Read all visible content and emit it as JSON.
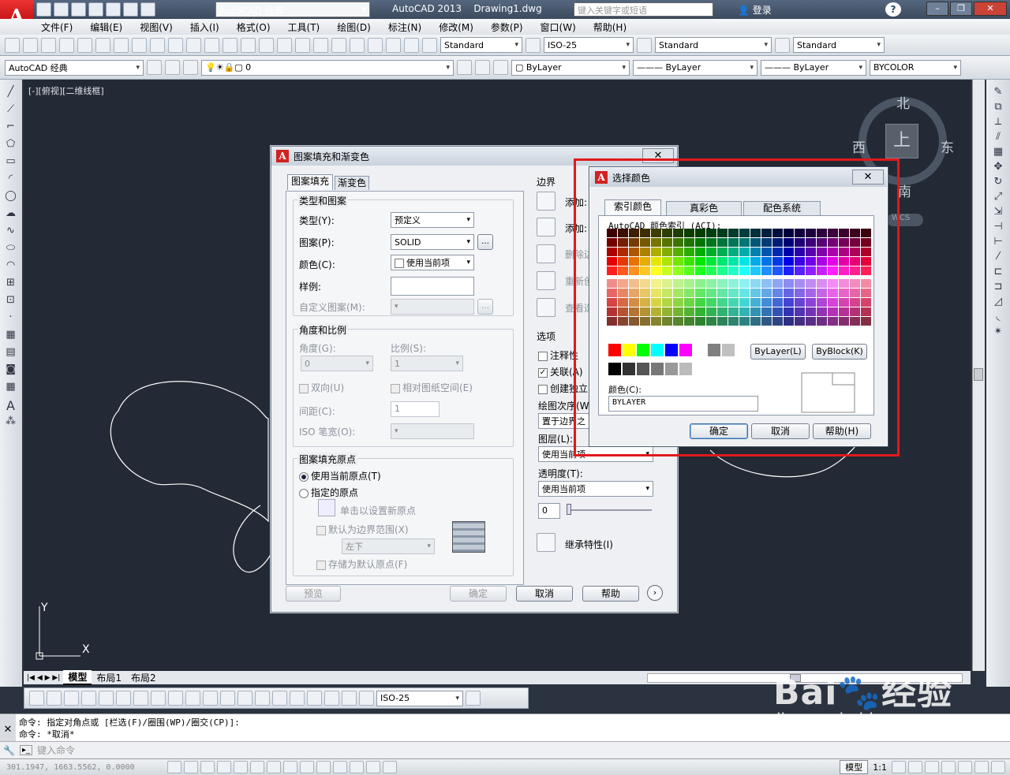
{
  "app": {
    "title": "AutoCAD 2013",
    "document": "Drawing1.dwg",
    "workspace": "AutoCAD 经典",
    "search_placeholder": "键入关键字或短语",
    "login": "登录"
  },
  "menu": [
    "文件(F)",
    "编辑(E)",
    "视图(V)",
    "插入(I)",
    "格式(O)",
    "工具(T)",
    "绘图(D)",
    "标注(N)",
    "修改(M)",
    "参数(P)",
    "窗口(W)",
    "帮助(H)"
  ],
  "toolbar": {
    "text_style": "Standard",
    "dim_style": "ISO-25",
    "table_style": "Standard",
    "mleader_style": "Standard",
    "workspace2": "AutoCAD 经典",
    "layer": "0",
    "color": "ByLayer",
    "linetype": "ByLayer",
    "lineweight": "ByLayer",
    "plotstyle": "BYCOLOR"
  },
  "viewport": {
    "label": "[-][俯视][二维线框]",
    "compass": {
      "n": "北",
      "s": "南",
      "w": "西",
      "e": "东",
      "top": "上",
      "wcs": "WCS"
    },
    "ucs_x": "X",
    "ucs_y": "Y"
  },
  "hatch_dialog": {
    "title": "图案填充和渐变色",
    "tabs": [
      "图案填充",
      "渐变色"
    ],
    "type_pattern": "类型和图案",
    "type_label": "类型(Y):",
    "type_value": "预定义",
    "pattern_label": "图案(P):",
    "pattern_value": "SOLID",
    "color_label": "颜色(C):",
    "color_value": "使用当前项",
    "swatch_label": "样例:",
    "custom_label": "自定义图案(M):",
    "angle_scale": "角度和比例",
    "angle_label": "角度(G):",
    "angle_value": "0",
    "scale_label": "比例(S):",
    "scale_value": "1",
    "double": "双向(U)",
    "relative": "相对图纸空间(E)",
    "spacing_label": "间距(C):",
    "spacing_value": "1",
    "iso_label": "ISO 笔宽(O):",
    "origin": "图案填充原点",
    "use_current": "使用当前原点(T)",
    "specified": "指定的原点",
    "click_set": "单击以设置新原点",
    "default_ext": "默认为边界范围(X)",
    "pos_value": "左下",
    "store": "存储为默认原点(F)",
    "boundary": "边界",
    "add_pick": "添加:",
    "add_select": "添加:",
    "remove": "删除边",
    "recreate": "重新创",
    "view": "查看选",
    "options": "选项",
    "annotative": "注释性",
    "assoc": "关联(A)",
    "create_sep": "创建独立",
    "draw_order": "绘图次序(W)",
    "draw_order_value": "置于边界之",
    "layer_label": "图层(L):",
    "layer_value": "使用当前项",
    "transp_label": "透明度(T):",
    "transp_value": "使用当前项",
    "transp_num": "0",
    "inherit": "继承特性(I)",
    "preview": "预览",
    "ok": "确定",
    "cancel": "取消",
    "help": "帮助"
  },
  "color_dialog": {
    "title": "选择颜色",
    "tabs": [
      "索引颜色",
      "真彩色",
      "配色系统"
    ],
    "aci_label": "AutoCAD 颜色索引 (ACI):",
    "bylayer": "ByLayer(L)",
    "byblock": "ByBlock(K)",
    "color_label": "颜色(C):",
    "color_value": "BYLAYER",
    "ok": "确定",
    "cancel": "取消",
    "help": "帮助(H)",
    "highlight_color": "#e0191b"
  },
  "layout_tabs": [
    "模型",
    "布局1",
    "布局2"
  ],
  "cmd": {
    "line1": "命令: 指定对角点或 [栏选(F)/圈围(WP)/圈交(CP)]:",
    "line2": "命令: *取消*",
    "placeholder": "键入命令"
  },
  "status": {
    "coords": "301.1947, 1663.5562, 0.0000",
    "model": "模型",
    "scale": "1:1",
    "dimstyle": "ISO-25"
  },
  "watermark": {
    "brand": "Bai",
    "brand2": "经验",
    "url": "jingyan.baidu.com"
  }
}
